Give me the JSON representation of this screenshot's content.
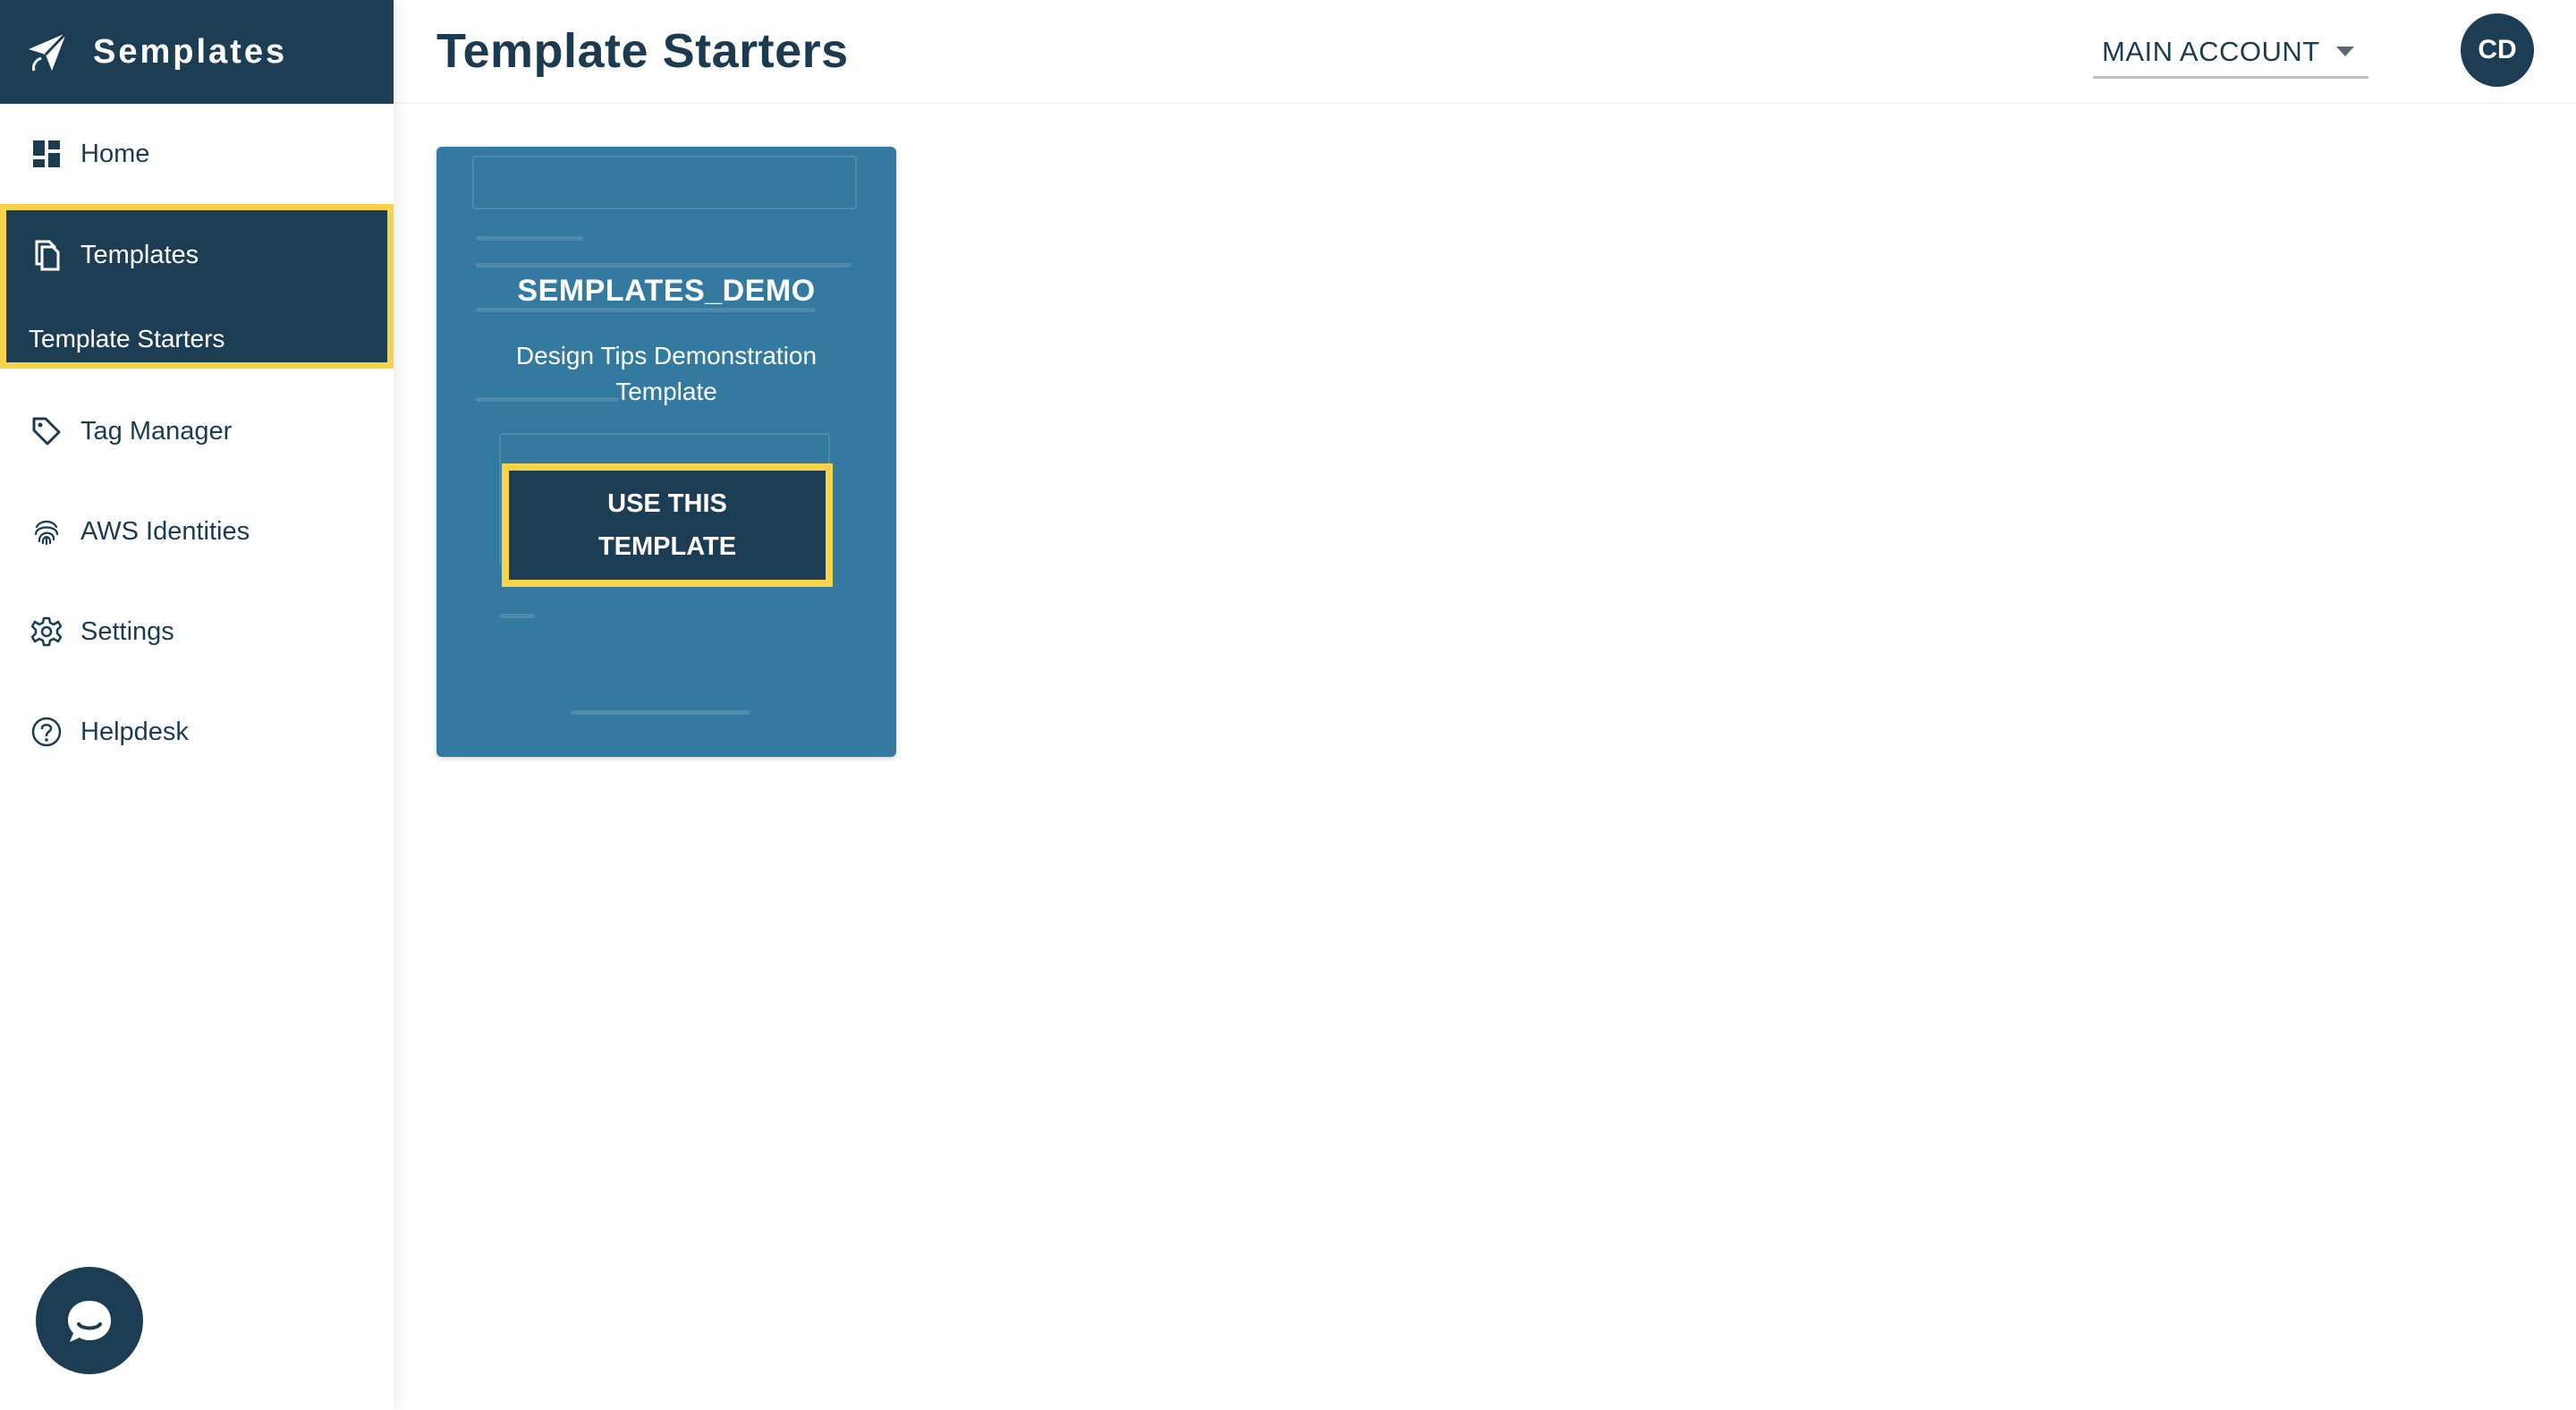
{
  "brand": {
    "name": "Semplates",
    "logo_icon": "paper-plane-icon"
  },
  "sidebar": {
    "items": [
      {
        "label": "Home",
        "icon": "dashboard-icon"
      },
      {
        "label": "Templates",
        "icon": "copy-document-icon",
        "active": true
      },
      {
        "label": "Template Starters",
        "active": true
      },
      {
        "label": "Tag Manager",
        "icon": "tag-icon"
      },
      {
        "label": "AWS Identities",
        "icon": "fingerprint-icon"
      },
      {
        "label": "Settings",
        "icon": "gear-icon"
      },
      {
        "label": "Helpdesk",
        "icon": "help-circle-icon"
      }
    ]
  },
  "header": {
    "title": "Template Starters",
    "account_label": "MAIN ACCOUNT",
    "avatar_initials": "CD"
  },
  "card": {
    "title": "SEMPLATES_DEMO",
    "description": "Design Tips Demonstration Template",
    "button_label": "USE THIS TEMPLATE"
  },
  "chat": {
    "icon": "chat-bubble-icon"
  },
  "colors": {
    "navy": "#1d3d55",
    "card_blue": "#3479a0",
    "highlight_yellow": "#f6d34a",
    "text": "#1d3b50",
    "background": "#ffffff"
  }
}
